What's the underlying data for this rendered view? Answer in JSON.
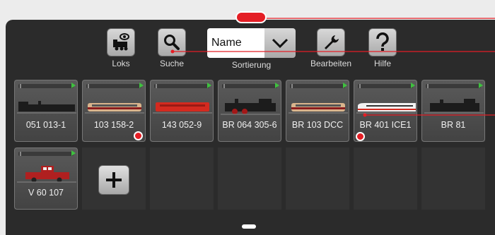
{
  "toolbar": {
    "locos_label": "Loks",
    "search_label": "Suche",
    "sort_label": "Sortierung",
    "sort_value": "Name",
    "edit_label": "Bearbeiten",
    "help_label": "Hilfe"
  },
  "locomotives": [
    {
      "name": "051 013-1",
      "color": "#1c1c1c",
      "marked": false
    },
    {
      "name": "103 158-2",
      "color": "#d9b48c",
      "marked": true
    },
    {
      "name": "143 052-9",
      "color": "#d42a1f",
      "marked": false
    },
    {
      "name": "BR 064 305-6",
      "color": "#1c1c1c",
      "marked": false
    },
    {
      "name": "BR 103 DCC",
      "color": "#d9b48c",
      "marked": false
    },
    {
      "name": "BR 401 ICE1",
      "color": "#f2f2f2",
      "marked": true
    },
    {
      "name": "BR 81",
      "color": "#1c1c1c",
      "marked": false
    },
    {
      "name": "V 60 107",
      "color": "#b02020",
      "marked": false
    }
  ],
  "accent_red": "#e41e25"
}
